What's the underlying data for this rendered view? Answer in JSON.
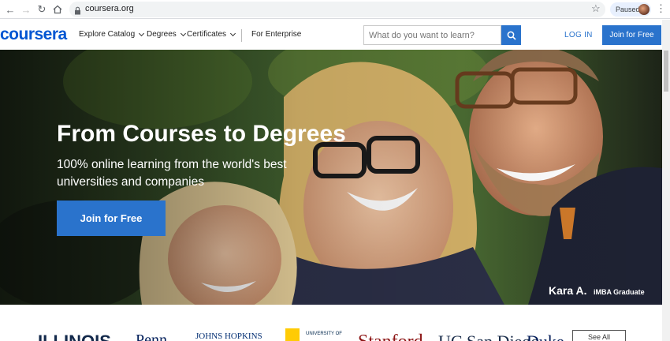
{
  "browser": {
    "url": "coursera.org",
    "profile_status": "Paused"
  },
  "header": {
    "logo_text": "coursera",
    "menu": [
      {
        "label": "Explore Catalog",
        "has_dropdown": true
      },
      {
        "label": "Degrees",
        "has_dropdown": true
      },
      {
        "label": "Certificates",
        "has_dropdown": true
      },
      {
        "label": "For Enterprise",
        "has_dropdown": false
      }
    ],
    "search_placeholder": "What do you want to learn?",
    "login_label": "LOG IN",
    "join_label": "Join for Free"
  },
  "hero": {
    "title": "From Courses to Degrees",
    "subtitle": "100% online learning from the world's best universities and companies",
    "cta_label": "Join for Free",
    "caption_name": "Kara A.",
    "caption_role": "iMBA Graduate"
  },
  "partners": [
    "ILLINOIS",
    "Penn",
    "JOHNS HOPKINS",
    "UNIVERSITY OF",
    "Stanford",
    "UC San Diego",
    "Duke"
  ],
  "see_all_label": "See All",
  "colors": {
    "brand_blue": "#0056d2",
    "button_blue": "#2a73cc"
  }
}
